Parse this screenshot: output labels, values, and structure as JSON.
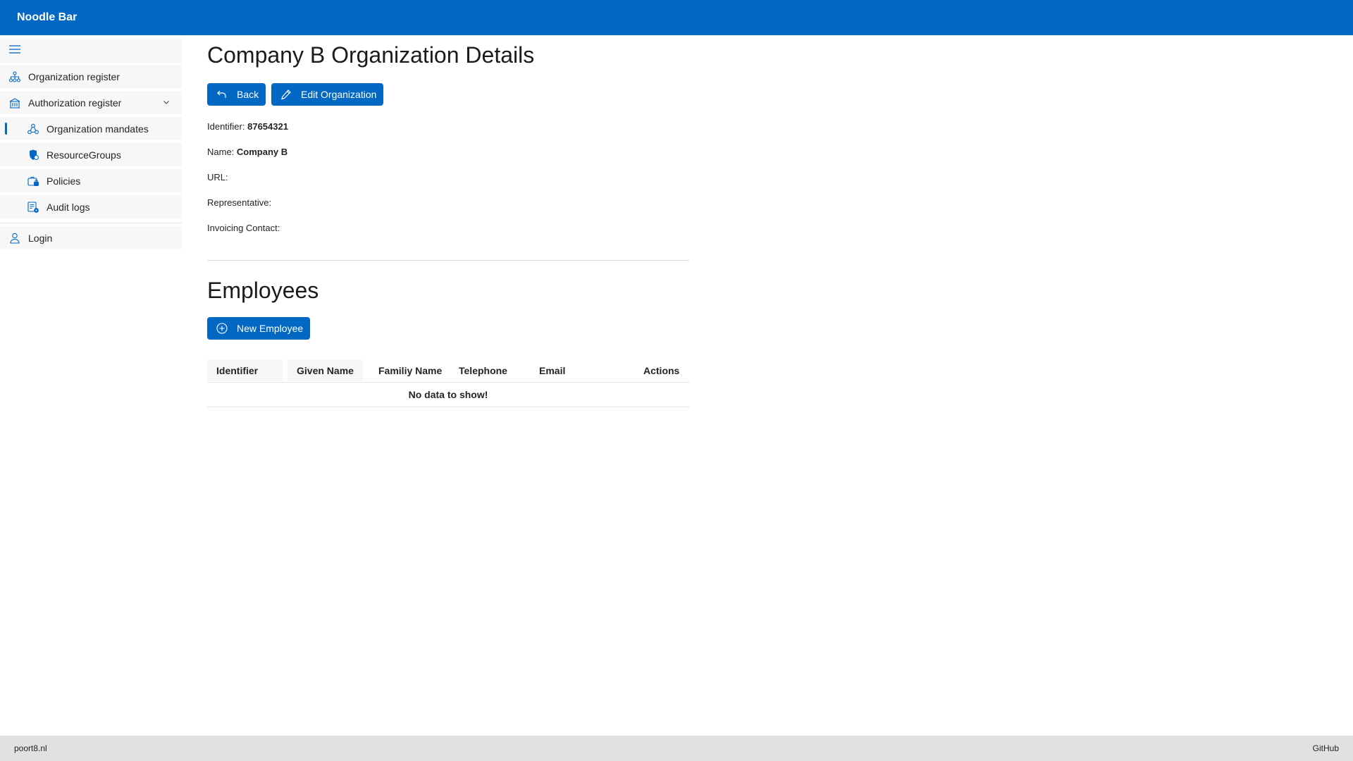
{
  "app": {
    "title": "Noodle Bar"
  },
  "sidebar": {
    "toggle_icon": "hamburger-icon",
    "items": [
      {
        "label": "Organization register",
        "icon": "org-tree-icon"
      },
      {
        "label": "Authorization register",
        "icon": "building-icon",
        "expanded": true
      },
      {
        "label": "Organization mandates",
        "icon": "people-network-icon",
        "active": true
      },
      {
        "label": "ResourceGroups",
        "icon": "shield-group-icon"
      },
      {
        "label": "Policies",
        "icon": "briefcase-lock-icon"
      },
      {
        "label": "Audit logs",
        "icon": "document-gear-icon"
      },
      {
        "label": "Login",
        "icon": "person-icon"
      }
    ]
  },
  "main": {
    "title": "Company B Organization Details",
    "back_label": "Back",
    "edit_label": "Edit Organization",
    "fields": {
      "identifier_label": "Identifier:",
      "identifier_value": "87654321",
      "name_label": "Name:",
      "name_value": "Company B",
      "url_label": "URL:",
      "url_value": "",
      "representative_label": "Representative:",
      "representative_value": "",
      "invoicing_label": "Invoicing Contact:",
      "invoicing_value": ""
    },
    "employees": {
      "title": "Employees",
      "new_label": "New Employee",
      "columns": [
        "Identifier",
        "Given Name",
        "Familiy Name",
        "Telephone",
        "Email",
        "Actions"
      ],
      "empty_text": "No data to show!"
    }
  },
  "footer": {
    "left": "poort8.nl",
    "right": "GitHub"
  },
  "colors": {
    "accent": "#0368c3",
    "footer_bg": "#e1e1e1"
  }
}
